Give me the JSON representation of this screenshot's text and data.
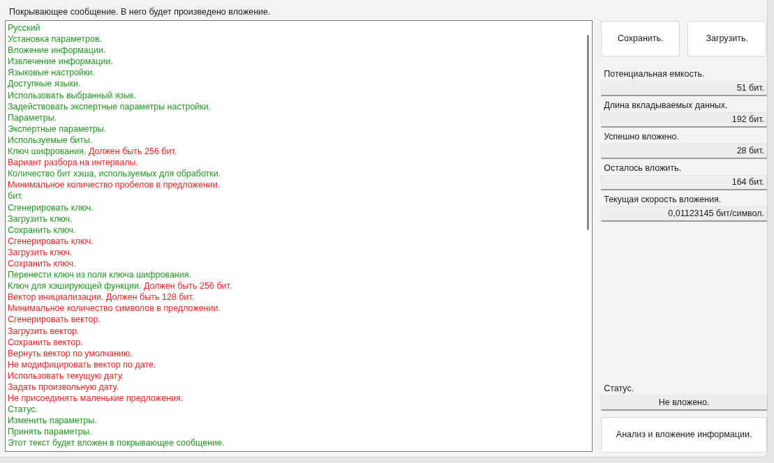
{
  "cover_label": "Покрывающее сообщение. В него будет произведено вложение.",
  "text_lines": [
    [
      {
        "text": "Русский",
        "color": "#1e9a1e"
      }
    ],
    [
      {
        "text": "Установка параметров.",
        "color": "#1e9a1e"
      }
    ],
    [
      {
        "text": "Вложение информации.",
        "color": "#1e9a1e"
      }
    ],
    [
      {
        "text": "Извлечение информации.",
        "color": "#1e9a1e"
      }
    ],
    [
      {
        "text": "Языковые настройки.",
        "color": "#1e9a1e"
      }
    ],
    [
      {
        "text": "Доступные языки.",
        "color": "#1e9a1e"
      }
    ],
    [
      {
        "text": "Использовать выбранный язык.",
        "color": "#1e9a1e"
      }
    ],
    [
      {
        "text": "Задействовать экспертные параметры настройки.",
        "color": "#1e9a1e"
      }
    ],
    [
      {
        "text": "Параметры.",
        "color": "#1e9a1e"
      }
    ],
    [
      {
        "text": "Экспертные параметры.",
        "color": "#1e9a1e"
      }
    ],
    [
      {
        "text": "Используемые биты.",
        "color": "#1e9a1e"
      }
    ],
    [
      {
        "text": "Ключ шифрования. ",
        "color": "#1e9a1e"
      },
      {
        "text": "Должен быть 256 бит.",
        "color": "#ff1e1e"
      }
    ],
    [
      {
        "text": "Вариант разбора на интервалы.",
        "color": "#ff1e1e"
      }
    ],
    [
      {
        "text": "Количество бит хэша, используемых для обработки.",
        "color": "#1e9a1e"
      }
    ],
    [
      {
        "text": "Минимальное количество пробелов в предложении.",
        "color": "#ff1e1e"
      }
    ],
    [
      {
        "text": "бит.",
        "color": "#1e9a1e"
      }
    ],
    [
      {
        "text": "Сгенерировать ключ.",
        "color": "#1e9a1e"
      }
    ],
    [
      {
        "text": "Загрузить ключ.",
        "color": "#1e9a1e"
      }
    ],
    [
      {
        "text": "Сохранить ключ.",
        "color": "#1e9a1e"
      }
    ],
    [
      {
        "text": "Сгенерировать ключ.",
        "color": "#ff1e1e"
      }
    ],
    [
      {
        "text": "Загрузить ключ.",
        "color": "#ff1e1e"
      }
    ],
    [
      {
        "text": "Сохранить ключ.",
        "color": "#ff1e1e"
      }
    ],
    [
      {
        "text": "Перенести ключ из поля ключа шифрования.",
        "color": "#1e9a1e"
      }
    ],
    [
      {
        "text": "Ключ для хэширующей функции. ",
        "color": "#1e9a1e"
      },
      {
        "text": "Должен быть 256 бит.",
        "color": "#ff1e1e"
      }
    ],
    [
      {
        "text": "Вектор инициализации. Должен быть 128 бит.",
        "color": "#ff1e1e"
      }
    ],
    [
      {
        "text": "Минимальное количество символов в предложении.",
        "color": "#ff1e1e"
      }
    ],
    [
      {
        "text": "Сгенерировать вектор.",
        "color": "#ff1e1e"
      }
    ],
    [
      {
        "text": "Загрузить вектор.",
        "color": "#ff1e1e"
      }
    ],
    [
      {
        "text": "Сохранить вектор.",
        "color": "#ff1e1e"
      }
    ],
    [
      {
        "text": "Вернуть вектор по умолчанию.",
        "color": "#ff1e1e"
      }
    ],
    [
      {
        "text": "Не модифицировать вектор по дате.",
        "color": "#ff1e1e"
      }
    ],
    [
      {
        "text": "Использовать текущую дату.",
        "color": "#ff1e1e"
      }
    ],
    [
      {
        "text": "Задать произвольную дату.",
        "color": "#ff1e1e"
      }
    ],
    [
      {
        "text": "Не присоединять маленькие предложения.",
        "color": "#ff1e1e"
      }
    ],
    [
      {
        "text": "Статус.",
        "color": "#1e9a1e"
      }
    ],
    [
      {
        "text": "Изменить параметры.",
        "color": "#1e9a1e"
      }
    ],
    [
      {
        "text": "Принять параметры.",
        "color": "#1e9a1e"
      }
    ],
    [
      {
        "text": "Этот текст будет вложен в покрывающее сообщение.",
        "color": "#1e9a1e"
      }
    ]
  ],
  "top_buttons": [
    "Сохранить.",
    "Загрузить."
  ],
  "stats": [
    {
      "label": "Потенциальная емкость.",
      "value": "51 бит."
    },
    {
      "label": "Длина вкладываемых данных.",
      "value": "192 бит."
    },
    {
      "label": "Успешно вложено.",
      "value": "28 бит."
    },
    {
      "label": "Осталось вложить.",
      "value": "164 бит."
    },
    {
      "label": "Текущая скорость вложения.",
      "value": "0,01123145 бит/символ."
    }
  ],
  "status": {
    "label": "Статус.",
    "value": "Не вложено."
  },
  "action_button": "Анализ и вложение информации."
}
